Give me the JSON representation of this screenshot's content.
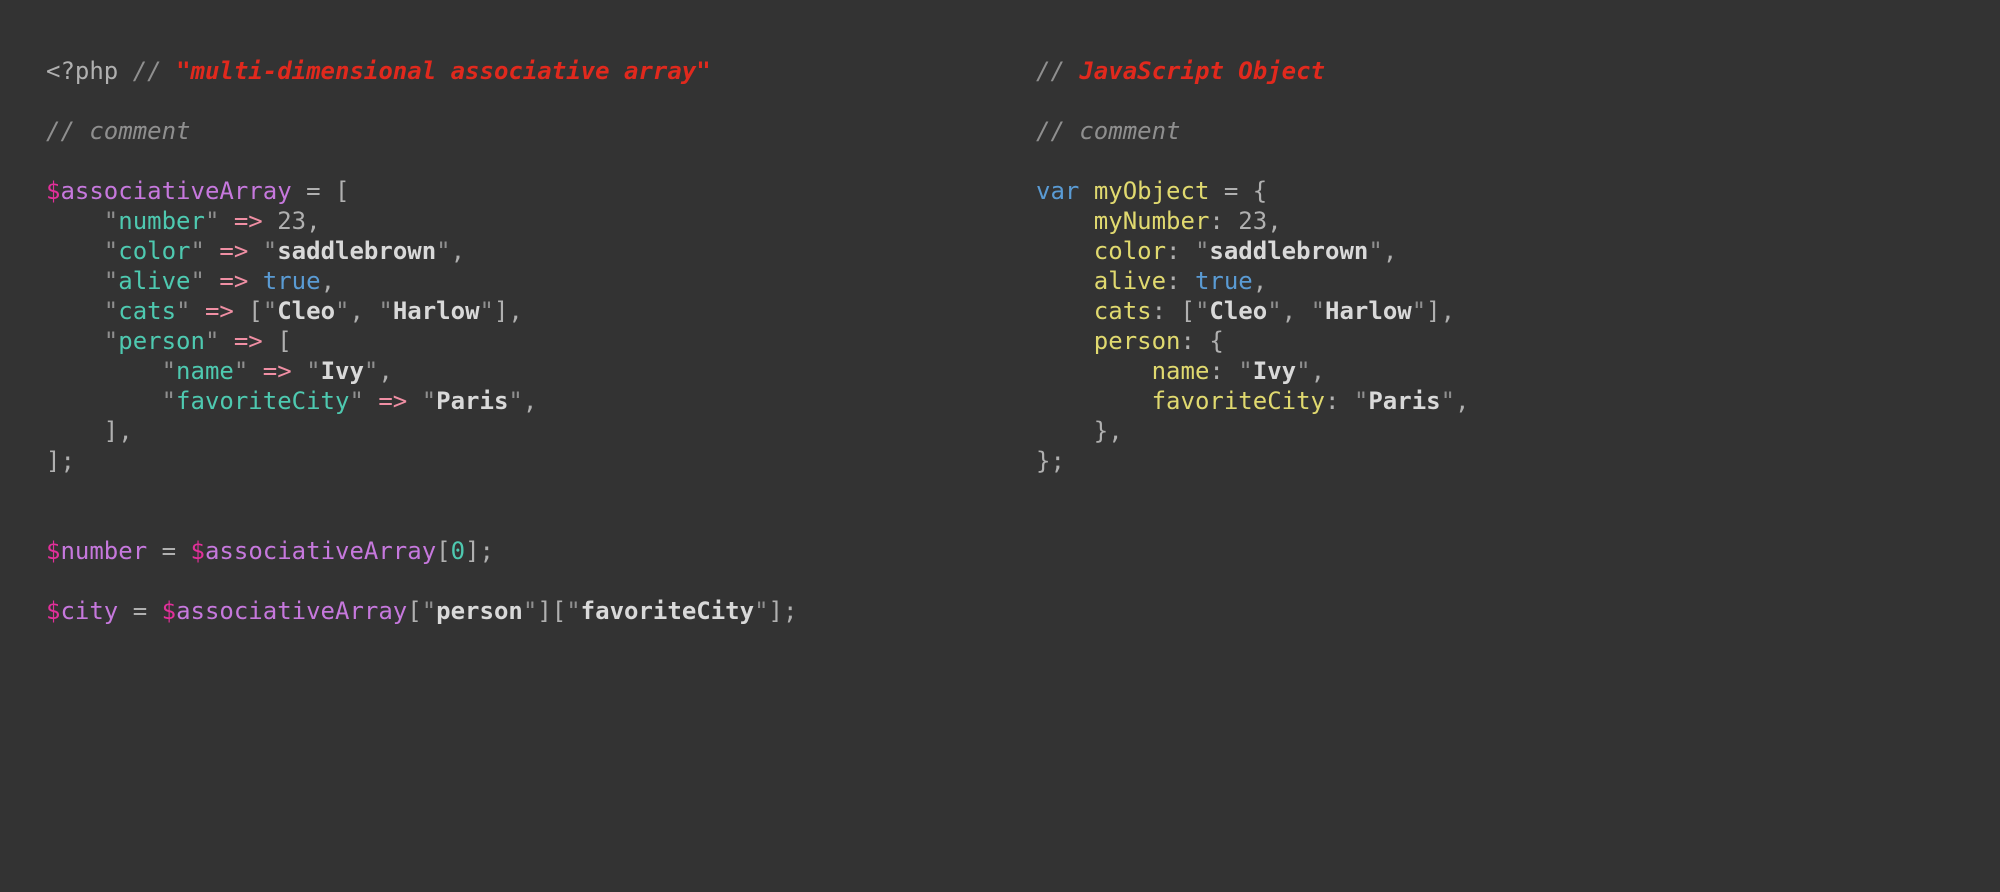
{
  "left": {
    "openTag": "<?php",
    "titleComment": "\"multi-dimensional associative array\"",
    "simpleComment": "comment",
    "arrVar": "associativeArray",
    "entries": {
      "numberKey": "number",
      "numberVal": "23",
      "colorKey": "color",
      "colorVal": "saddlebrown",
      "aliveKey": "alive",
      "aliveVal": "true",
      "catsKey": "cats",
      "cat1": "Cleo",
      "cat2": "Harlow",
      "personKey": "person",
      "nameKey": "name",
      "nameVal": "Ivy",
      "favCityKey": "favoriteCity",
      "favCityVal": "Paris"
    },
    "numVar": "number",
    "cityVar": "city",
    "idx0": "0",
    "idxPerson": "person",
    "idxFavCity": "favoriteCity"
  },
  "right": {
    "titleComment": "JavaScript Object",
    "simpleComment": "comment",
    "kwVar": "var",
    "objName": "myObject",
    "entries": {
      "numberKey": "myNumber",
      "numberVal": "23",
      "colorKey": "color",
      "colorVal": "saddlebrown",
      "aliveKey": "alive",
      "aliveVal": "true",
      "catsKey": "cats",
      "cat1": "Cleo",
      "cat2": "Harlow",
      "personKey": "person",
      "nameKey": "name",
      "nameVal": "Ivy",
      "favCityKey": "favoriteCity",
      "favCityVal": "Paris"
    }
  }
}
